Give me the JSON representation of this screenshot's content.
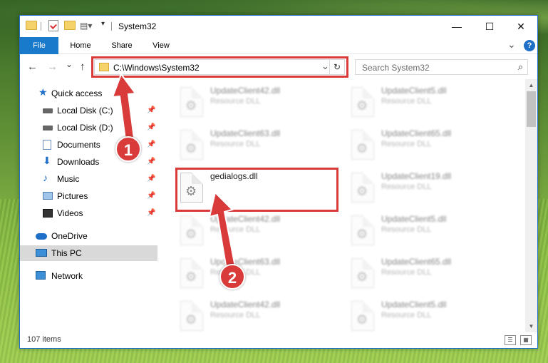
{
  "window": {
    "title": "System32",
    "minimize_glyph": "—",
    "maximize_glyph": "☐",
    "close_glyph": "✕"
  },
  "ribbon": {
    "tabs": [
      {
        "label": "File",
        "active": true
      },
      {
        "label": "Home"
      },
      {
        "label": "Share"
      },
      {
        "label": "View"
      }
    ],
    "expand_glyph": "⌄",
    "help_glyph": "?"
  },
  "address": {
    "path": "C:\\Windows\\System32",
    "back_glyph": "←",
    "forward_glyph": "→",
    "recent_glyph": "⌄",
    "up_glyph": "↑",
    "dropdown_glyph": "⌄",
    "refresh_glyph": "↻"
  },
  "search": {
    "placeholder": "Search System32",
    "icon_glyph": "⌕"
  },
  "nav": {
    "items": [
      {
        "label": "Quick access",
        "icon": "star-icon",
        "pinned": false
      },
      {
        "label": "Local Disk (C:)",
        "icon": "drive-icon",
        "pinned": true
      },
      {
        "label": "Local Disk (D:)",
        "icon": "drive-icon",
        "pinned": true
      },
      {
        "label": "Documents",
        "icon": "documents-icon",
        "pinned": true
      },
      {
        "label": "Downloads",
        "icon": "downloads-icon",
        "pinned": true
      },
      {
        "label": "Music",
        "icon": "music-icon",
        "pinned": true
      },
      {
        "label": "Pictures",
        "icon": "pictures-icon",
        "pinned": true
      },
      {
        "label": "Videos",
        "icon": "videos-icon",
        "pinned": true
      },
      {
        "label": "OneDrive",
        "icon": "cloud-icon",
        "pinned": false
      },
      {
        "label": "This PC",
        "icon": "computer-icon",
        "pinned": false,
        "selected": true
      },
      {
        "label": "Network",
        "icon": "network-icon",
        "pinned": false
      }
    ],
    "pin_glyph": "📌"
  },
  "files": [
    {
      "name": "UpdateClient42.dll",
      "type": "Resource DLL",
      "blurred": true
    },
    {
      "name": "UpdateClient5.dll",
      "type": "Resource DLL",
      "blurred": true
    },
    {
      "name": "UpdateClient63.dll",
      "type": "Resource DLL",
      "blurred": true
    },
    {
      "name": "UpdateClient65.dll",
      "type": "Resource DLL",
      "blurred": true
    },
    {
      "name": "gedialogs.dll",
      "type": "",
      "blurred": false
    },
    {
      "name": "UpdateClient19.dll",
      "type": "Resource DLL",
      "blurred": true
    },
    {
      "name": "UpdateClient42.dll",
      "type": "Resource DLL",
      "blurred": true
    },
    {
      "name": "UpdateClient5.dll",
      "type": "Resource DLL",
      "blurred": true
    },
    {
      "name": "UpdateClient63.dll",
      "type": "Resource DLL",
      "blurred": true
    },
    {
      "name": "UpdateClient65.dll",
      "type": "Resource DLL",
      "blurred": true
    },
    {
      "name": "UpdateClient42.dll",
      "type": "Resource DLL",
      "blurred": true
    },
    {
      "name": "UpdateClient5.dll",
      "type": "Resource DLL",
      "blurred": true
    }
  ],
  "status": {
    "item_count": "107 items"
  },
  "callouts": {
    "step1": "1",
    "step2": "2",
    "color": "#d93a3a"
  }
}
